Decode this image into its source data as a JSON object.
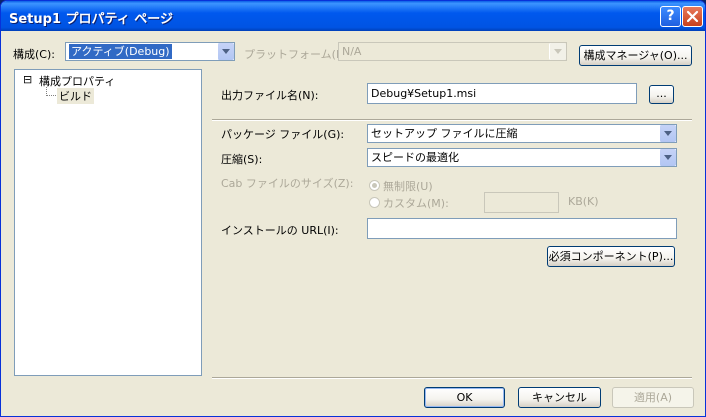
{
  "window": {
    "title": "Setup1 プロパティ ページ",
    "help_label": "?"
  },
  "top": {
    "config_label": "構成(C):",
    "config_value": "アクティブ(Debug)",
    "platform_label": "プラットフォーム(P):",
    "platform_value": "N/A",
    "config_manager_label": "構成マネージャ(O)..."
  },
  "tree": {
    "items": [
      {
        "label": "構成プロパティ",
        "expander": "⊟"
      },
      {
        "label": "ビルド"
      }
    ]
  },
  "form": {
    "output_label": "出力ファイル名(N):",
    "output_value": "Debug¥Setup1.msi",
    "browse_label": "...",
    "package_label": "パッケージ ファイル(G):",
    "package_value": "セットアップ ファイルに圧縮",
    "compress_label": "圧縮(S):",
    "compress_value": "スピードの最適化",
    "cab_label": "Cab ファイルのサイズ(Z):",
    "unlimited_label": "無制限(U)",
    "custom_label": "カスタム(M):",
    "kb_label": "KB(K)",
    "url_label": "インストールの URL(I):",
    "url_value": "",
    "prereq_label": "必須コンポーネント(P)..."
  },
  "footer": {
    "ok_label": "OK",
    "cancel_label": "キャンセル",
    "apply_label": "適用(A)"
  },
  "colors": {
    "titlebar": "#0054e3",
    "face": "#ece9d8",
    "selection": "#316ac5",
    "close": "#c8401d"
  }
}
